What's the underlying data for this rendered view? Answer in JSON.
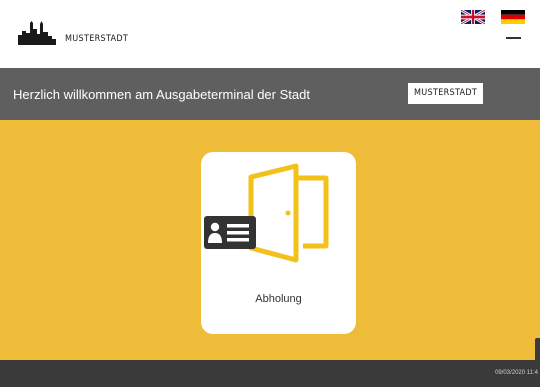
{
  "header": {
    "logo_text": "MUSTERSTADT",
    "languages": [
      {
        "code": "en",
        "icon": "uk-flag-icon"
      },
      {
        "code": "de",
        "icon": "germany-flag-icon",
        "selected": true
      }
    ]
  },
  "welcome": {
    "text": "Herzlich willkommen am Ausgabeterminal der Stadt",
    "city": "MUSTERSTADT"
  },
  "actions": [
    {
      "label": "Abholung",
      "icon": "id-card-door-icon"
    }
  ],
  "footer": {
    "timestamp": "09/03/2020 11:4"
  },
  "colors": {
    "accent": "#efbc39",
    "bar": "#5f5f5f",
    "footer": "#3a3a3a",
    "icon_yellow": "#f2c21b",
    "icon_dark": "#333333"
  }
}
